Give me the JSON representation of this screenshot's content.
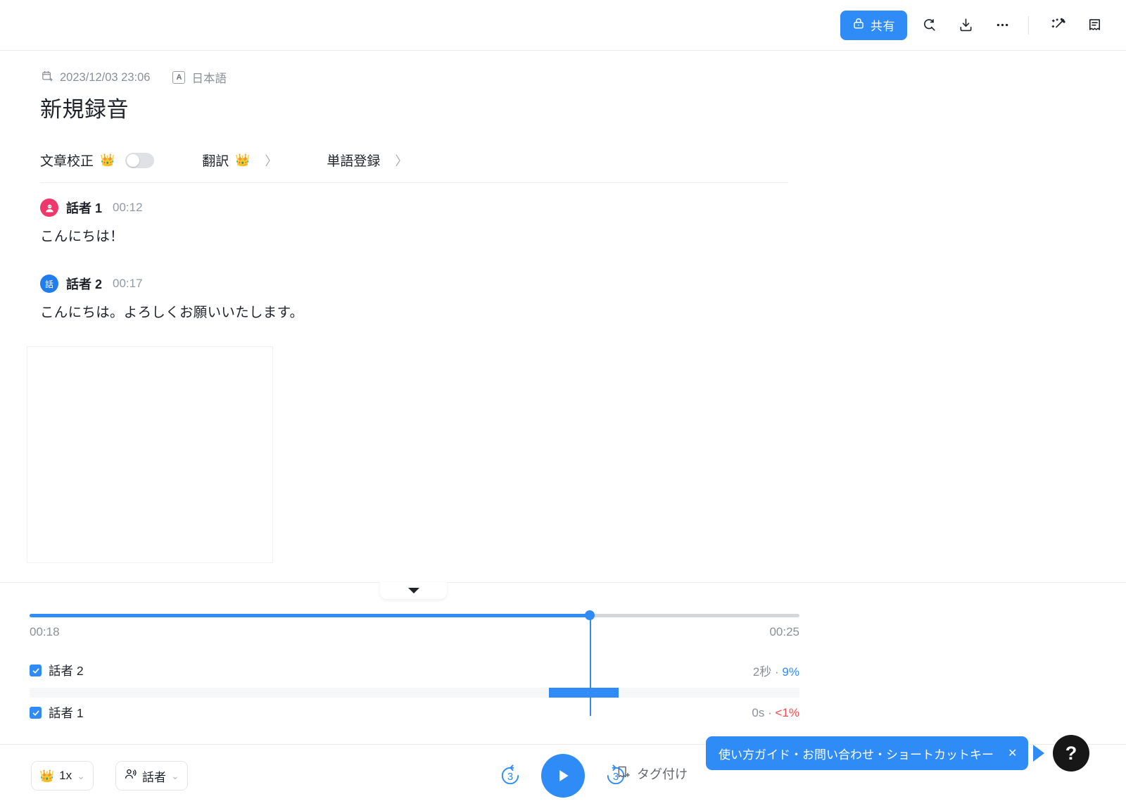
{
  "header": {
    "share_label": "共有",
    "icons": [
      {
        "name": "lock-icon"
      },
      {
        "name": "search-icon"
      },
      {
        "name": "download-icon"
      },
      {
        "name": "more-icon"
      },
      {
        "name": "magic-wand-icon"
      },
      {
        "name": "notes-icon"
      }
    ],
    "accent_color": "#2f8bf5"
  },
  "meta": {
    "timestamp": "2023/12/03 23:06",
    "lang_badge": "A",
    "language": "日本語"
  },
  "title": "新規録音",
  "features": {
    "proofread_label": "文章校正",
    "proofread_premium": "👑",
    "proofread_enabled": false,
    "translate_label": "翻訳",
    "translate_premium": "👑",
    "glossary_label": "単語登録",
    "chevron": "〉"
  },
  "transcript": {
    "segments": [
      {
        "avatar_text": "",
        "avatar_color": "#f0376b",
        "speaker": "話者 1",
        "time": "00:12",
        "text": "こんにちは！"
      },
      {
        "avatar_text": "話",
        "avatar_color": "#1f7df0",
        "speaker": "話者 2",
        "time": "00:17",
        "text": "こんにちは。よろしくお願いいたします。"
      }
    ]
  },
  "player": {
    "current_time": "00:18",
    "total_time": "00:25",
    "progress_percent": 72.8,
    "speakers": [
      {
        "label": "話者 2",
        "checked": true,
        "duration": "2秒",
        "separator": "·",
        "percent": "9%",
        "percent_color": "blue",
        "segment_start_percent": 67.5,
        "segment_width_percent": 9.0
      },
      {
        "label": "話者 1",
        "checked": true,
        "duration": "0s",
        "separator": "·",
        "percent": "<1%",
        "percent_color": "red",
        "segment_start_percent": 0,
        "segment_width_percent": 0
      }
    ]
  },
  "bottom": {
    "speed_value": "1x",
    "speed_premium": "👑",
    "speaker_filter_label": "話者",
    "rewind_seconds": "3",
    "forward_seconds": "3",
    "tag_label": "タグ付け",
    "guide_text": "使い方ガイド・お問い合わせ・ショートカットキー",
    "guide_close": "✕",
    "help_label": "?"
  }
}
